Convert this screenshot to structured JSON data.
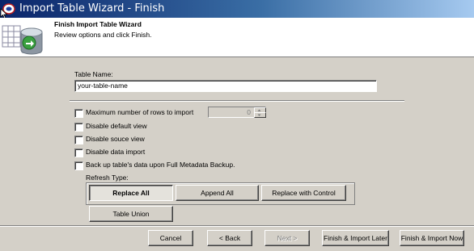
{
  "window": {
    "title": "Import Table Wizard - Finish"
  },
  "header": {
    "title": "Finish Import Table Wizard",
    "subtitle": "Review options and click Finish."
  },
  "form": {
    "table_name_label": "Table Name:",
    "table_name_value": "your-table-name",
    "max_rows_label": "Maximum number of rows to import",
    "max_rows_value": "0",
    "disable_default_view_label": "Disable default view",
    "disable_source_view_label": "Disable souce view",
    "disable_data_import_label": "Disable data import",
    "backup_label": "Back up table's data upon Full Metadata Backup.",
    "refresh_type_label": "Refresh Type:",
    "refresh_options": [
      "Replace All",
      "Append All",
      "Replace with Control"
    ],
    "selected_refresh": "Replace All",
    "table_union_label": "Table Union"
  },
  "footer": {
    "cancel_label": "Cancel",
    "back_label": "< Back",
    "next_label": "Next >",
    "finish_later_label": "Finish & Import Later",
    "finish_now_label": "Finish & Import Now"
  },
  "colors": {
    "titlebar_start": "#0a246a",
    "titlebar_end": "#a6caf0",
    "face": "#d4d0c8"
  }
}
